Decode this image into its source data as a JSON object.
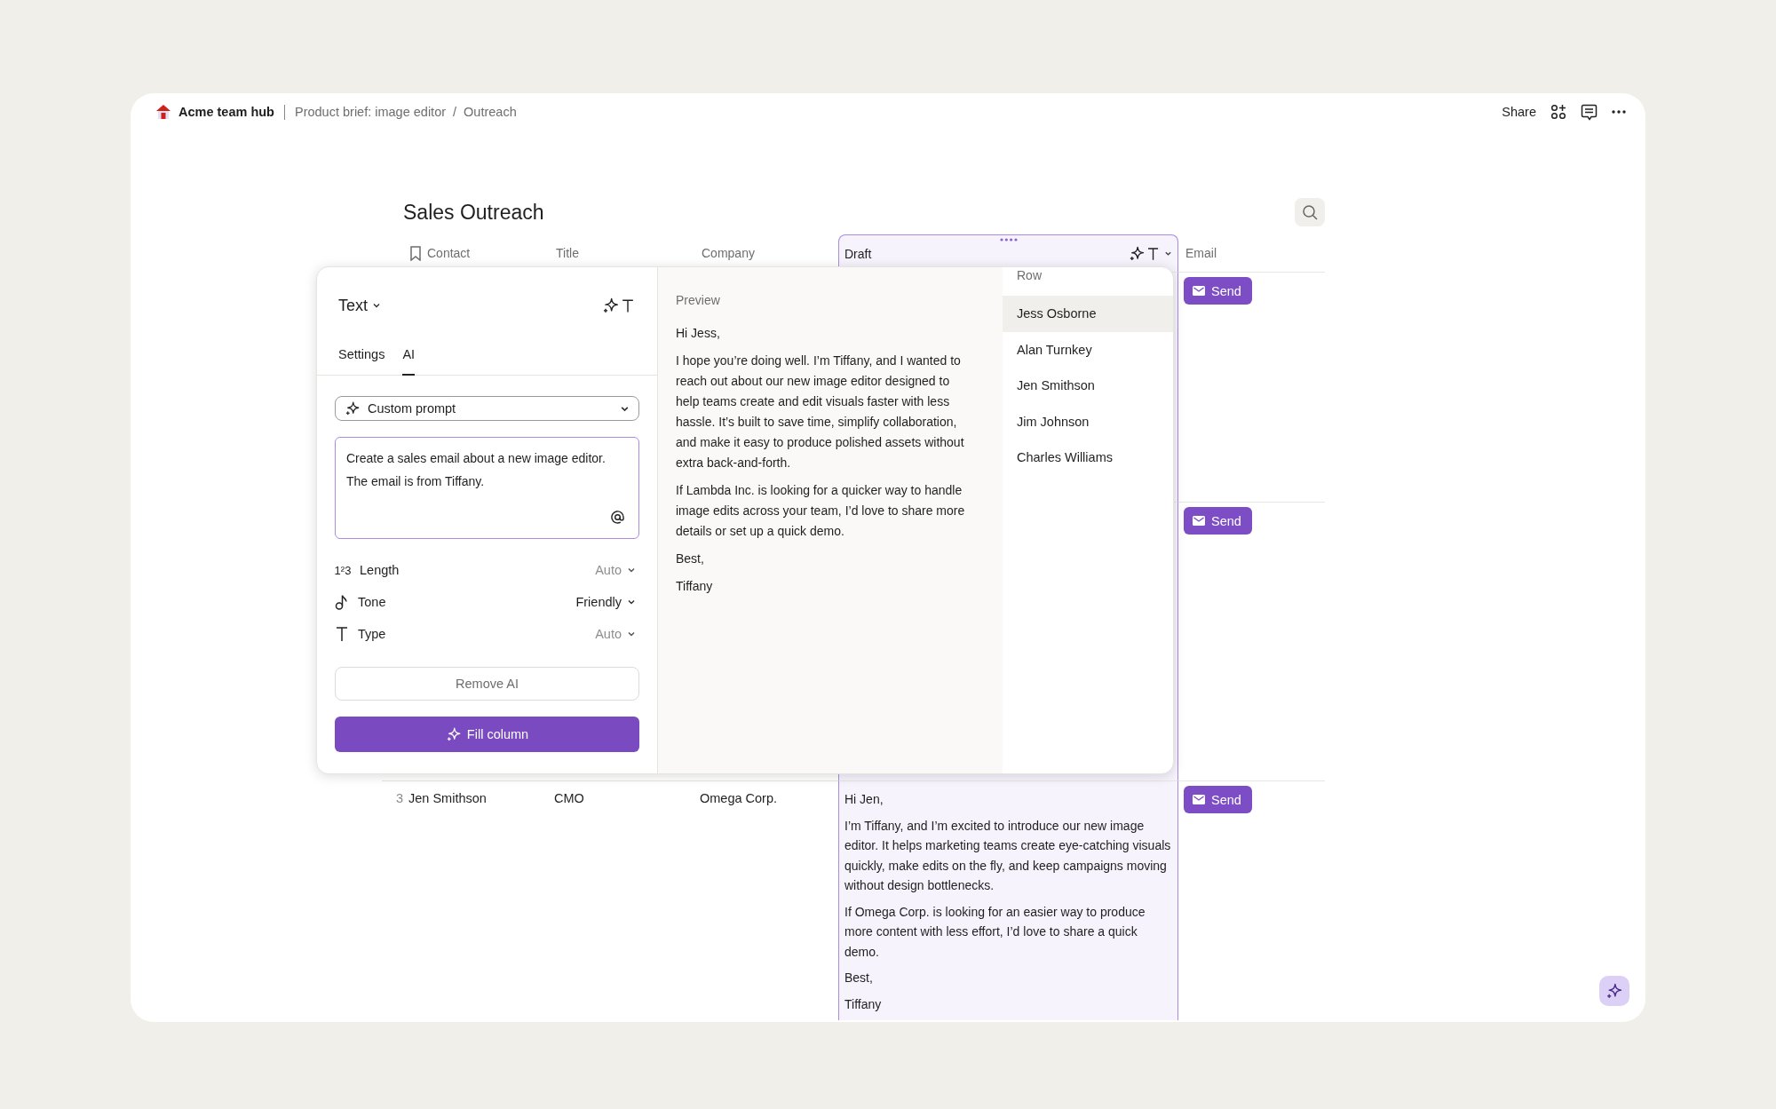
{
  "breadcrumb": {
    "workspace": "Acme team hub",
    "pages": [
      "Product brief: image editor",
      "Outreach"
    ],
    "separator": "/"
  },
  "toolbar": {
    "share": "Share"
  },
  "page": {
    "title": "Sales Outreach"
  },
  "table": {
    "columns": [
      {
        "label": "Contact",
        "kind": "contact"
      },
      {
        "label": "Title",
        "kind": "plain"
      },
      {
        "label": "Company",
        "kind": "plain"
      },
      {
        "label": "Draft",
        "kind": "ai"
      },
      {
        "label": "Email",
        "kind": "plain"
      }
    ],
    "rows": [
      {
        "send": "Send"
      },
      {
        "send": "Send"
      },
      {
        "number": "3",
        "contact": "Jen Smithson",
        "title": "CMO",
        "company": "Omega Corp.",
        "draft": [
          "Hi Jen,",
          "I’m Tiffany, and I’m excited to introduce our new image editor. It helps marketing teams create eye-catching visuals quickly, make edits on the fly, and keep campaigns moving without design bottlenecks.",
          "If Omega Corp. is looking for an easier way to produce more content with less effort, I’d love to share a quick demo.",
          "Best,",
          "Tiffany"
        ],
        "send": "Send"
      }
    ]
  },
  "column_editor": {
    "type_label": "Text",
    "tabs": [
      {
        "label": "Settings",
        "selected": false
      },
      {
        "label": "AI",
        "selected": true
      }
    ],
    "prompt_mode": "Custom prompt",
    "prompt": "Create a sales email about a new image editor. The email is from Tiffany.",
    "options": [
      {
        "kind": "length",
        "glyph": "1²3",
        "label": "Length",
        "value": "Auto",
        "default": true
      },
      {
        "kind": "tone",
        "label": "Tone",
        "value": "Friendly",
        "default": false
      },
      {
        "kind": "type",
        "label": "Type",
        "value": "Auto",
        "default": true
      }
    ],
    "remove_button": "Remove AI",
    "fill_button": "Fill column"
  },
  "preview": {
    "label": "Preview",
    "paragraphs": [
      "Hi Jess,",
      "I hope you’re doing well. I’m Tiffany, and I wanted to reach out about our new image editor designed to help teams create and edit visuals faster with less hassle. It’s built to save time, simplify collaboration, and make it easy to produce polished assets without extra back-and-forth.",
      "If Lambda Inc. is looking for a quicker way to handle image edits across your team, I’d love to share more details or set up a quick demo.",
      "Best,",
      "Tiffany"
    ]
  },
  "row_picker": {
    "label": "Row",
    "rows": [
      {
        "name": "Jess Osborne",
        "selected": true
      },
      {
        "name": "Alan Turnkey",
        "selected": false
      },
      {
        "name": "Jen Smithson",
        "selected": false
      },
      {
        "name": "Jim Johnson",
        "selected": false
      },
      {
        "name": "Charles Williams",
        "selected": false
      }
    ]
  }
}
